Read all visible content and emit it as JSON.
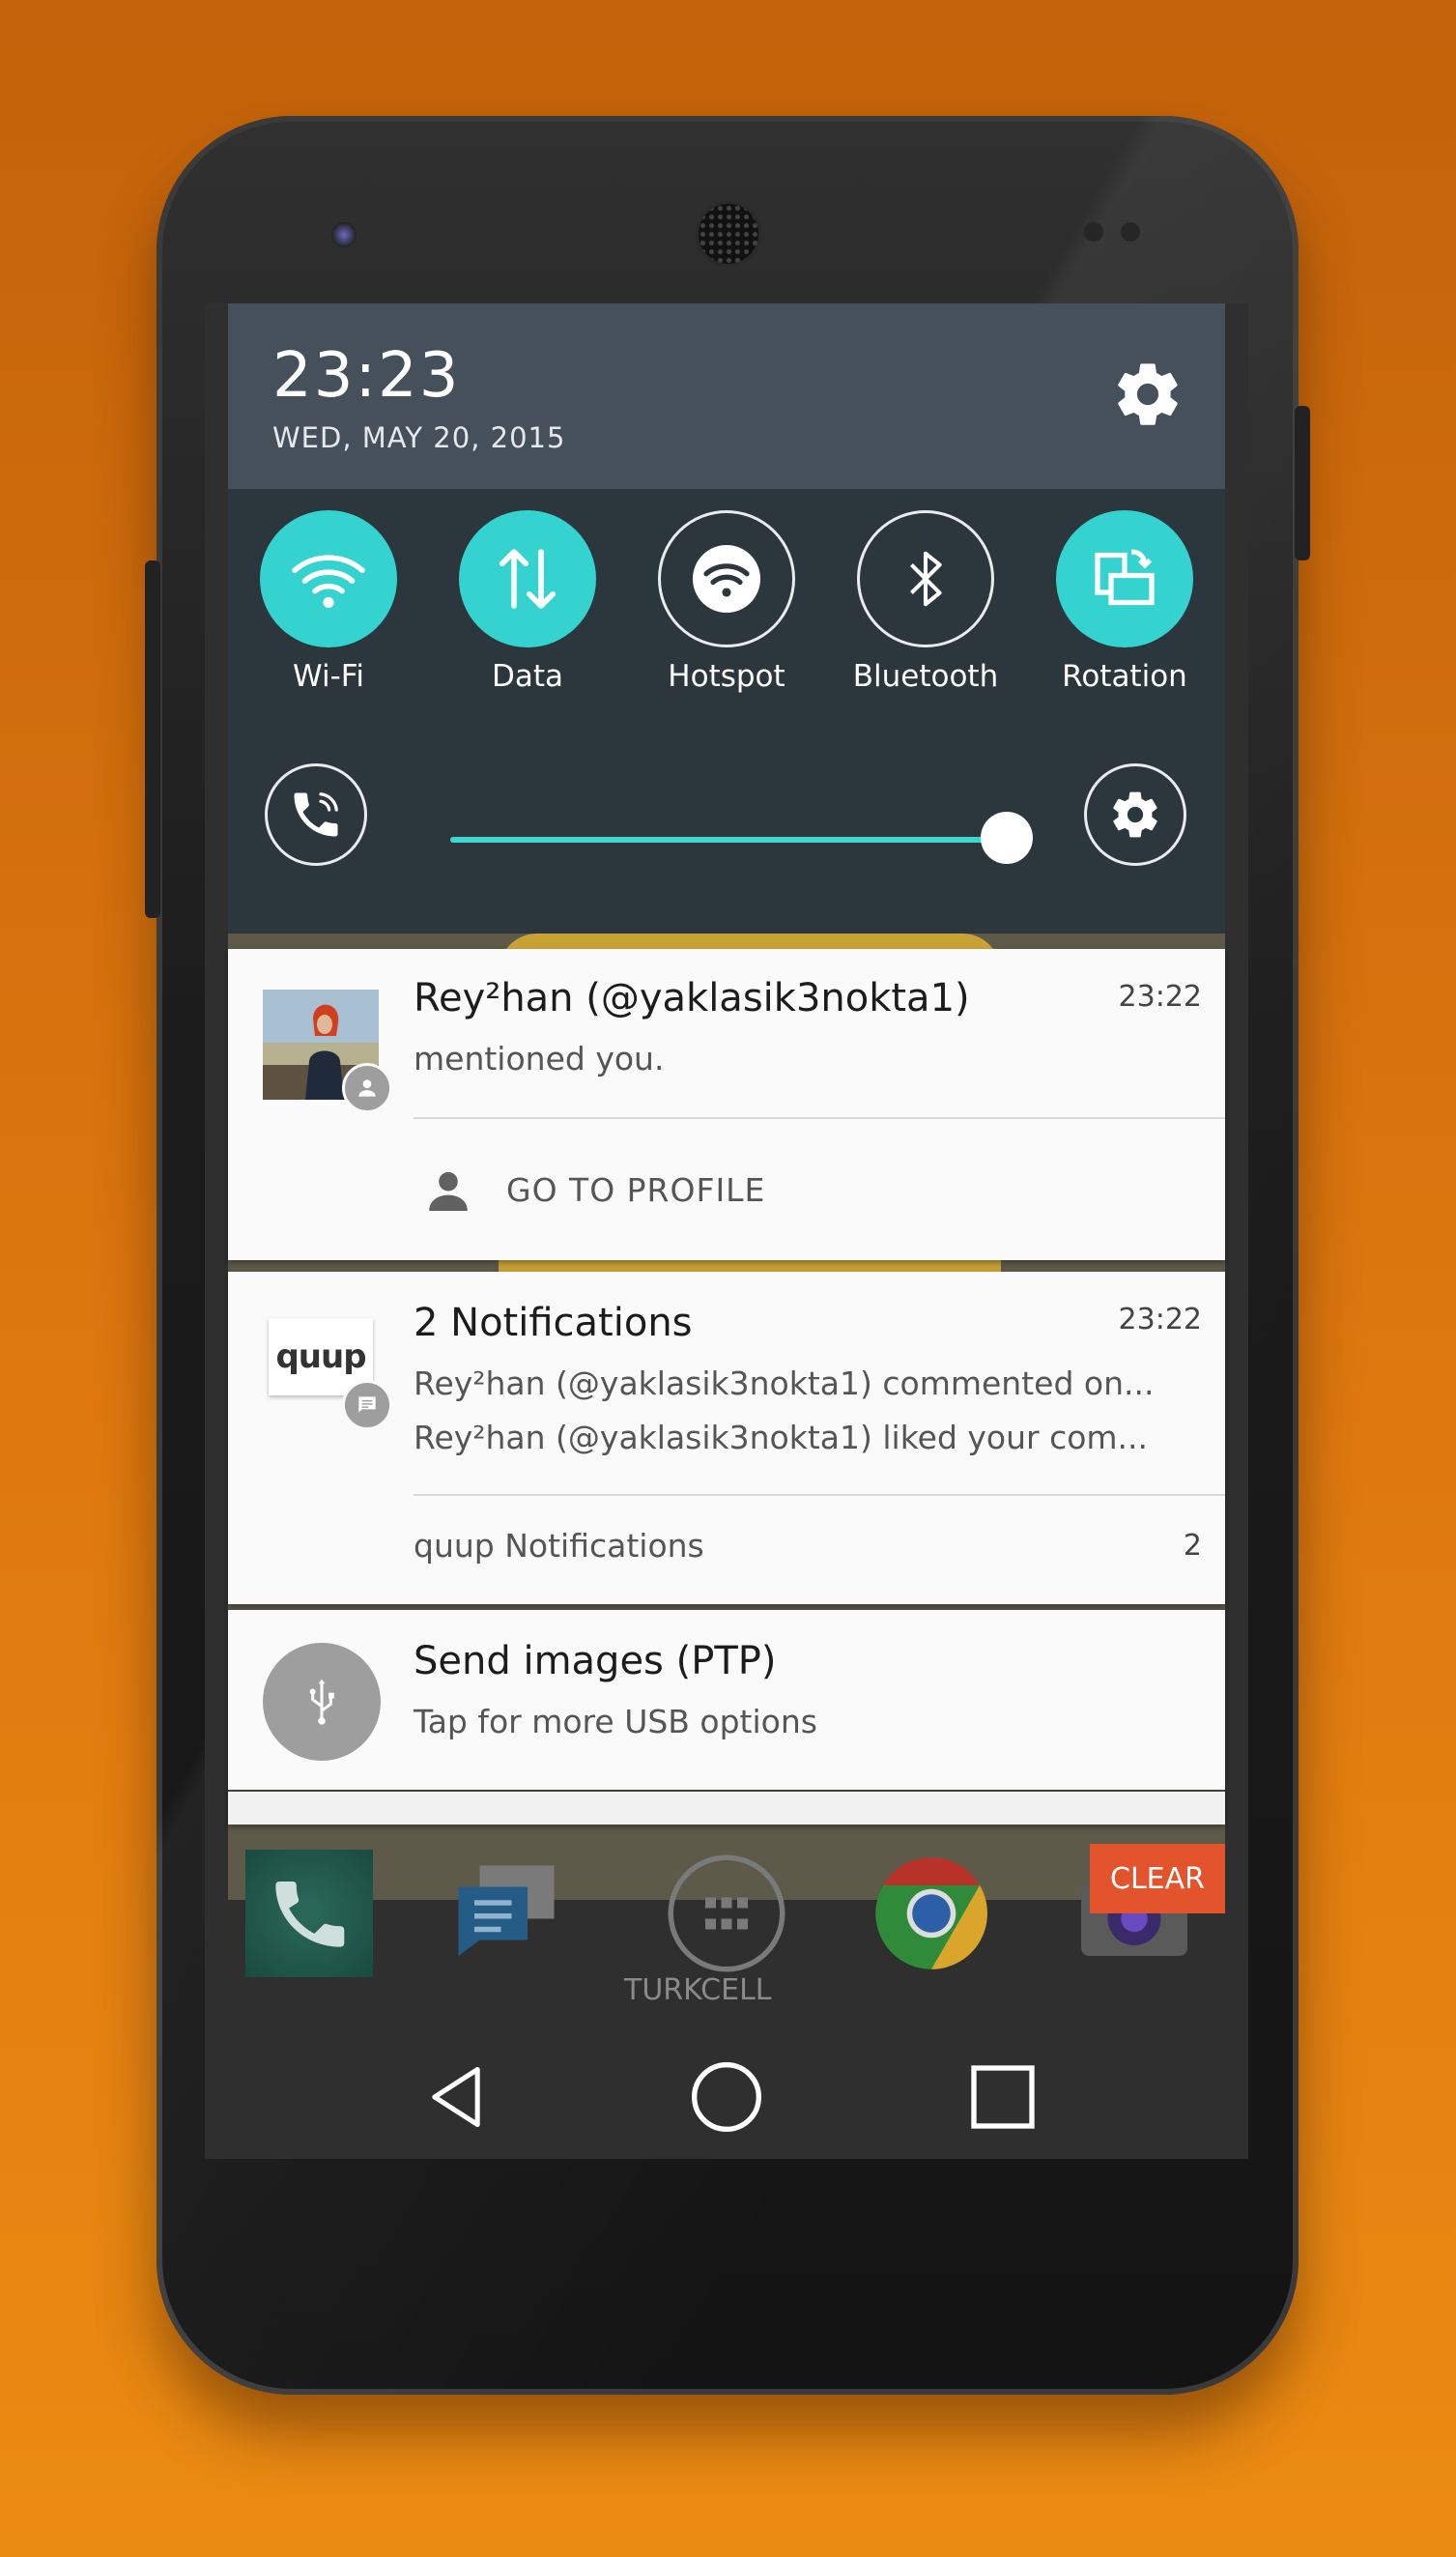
{
  "header": {
    "time": "23:23",
    "date": "WED, MAY 20, 2015",
    "settings_icon": "gear-icon"
  },
  "quick_settings": {
    "tiles": [
      {
        "label": "Wi-Fi",
        "icon": "wifi-icon",
        "state": "on"
      },
      {
        "label": "Data",
        "icon": "data-arrows-icon",
        "state": "on"
      },
      {
        "label": "Hotspot",
        "icon": "hotspot-icon",
        "state": "off"
      },
      {
        "label": "Bluetooth",
        "icon": "bluetooth-icon",
        "state": "off"
      },
      {
        "label": "Rotation",
        "icon": "rotation-icon",
        "state": "on"
      }
    ],
    "brightness_level": 1.0,
    "accent_color": "#35d3cf"
  },
  "notifications": [
    {
      "title": "Rey²han (@yaklasik3nokta1)",
      "body": "mentioned you.",
      "time": "23:22",
      "action_label": "GO TO PROFILE",
      "action_icon": "person-icon"
    },
    {
      "title": "2 Notifications",
      "time": "23:22",
      "app_icon_text": "quup",
      "lines": [
        "Rey²han (@yaklasik3nokta1) commented on...",
        "Rey²han (@yaklasik3nokta1) liked your com..."
      ],
      "footer_label": "quup Notifications",
      "footer_count": "2"
    },
    {
      "title": "Send images (PTP)",
      "body": "Tap for more USB options",
      "icon": "usb-icon"
    }
  ],
  "dock": {
    "carrier": "TURKCELL",
    "clear_label": "CLEAR"
  },
  "navbar": {
    "back": "back-icon",
    "home": "home-icon",
    "recents": "recents-icon"
  }
}
